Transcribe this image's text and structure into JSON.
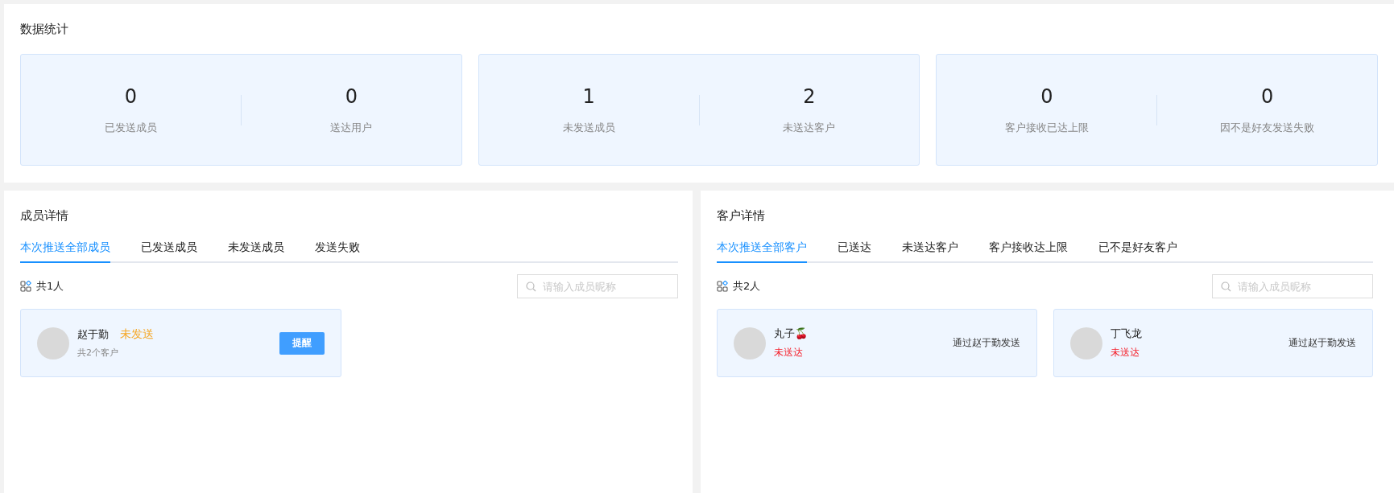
{
  "stats": {
    "title": "数据统计",
    "cards": [
      {
        "items": [
          {
            "value": "0",
            "label": "已发送成员"
          },
          {
            "value": "0",
            "label": "送达用户"
          }
        ]
      },
      {
        "items": [
          {
            "value": "1",
            "label": "未发送成员"
          },
          {
            "value": "2",
            "label": "未送达客户"
          }
        ]
      },
      {
        "items": [
          {
            "value": "0",
            "label": "客户接收已达上限"
          },
          {
            "value": "0",
            "label": "因不是好友发送失败"
          }
        ]
      }
    ]
  },
  "panels": [
    {
      "title": "成员详情",
      "tabs": [
        {
          "label": "本次推送全部成员",
          "selected": true
        },
        {
          "label": "已发送成员",
          "selected": false
        },
        {
          "label": "未发送成员",
          "selected": false
        },
        {
          "label": "发送失败",
          "selected": false
        }
      ],
      "count": "共1人",
      "search": {
        "placeholder": "请输入成员昵称"
      },
      "cards": [
        {
          "kind": "member",
          "name": "赵于勤",
          "status": {
            "text": "未发送",
            "kind": "pending"
          },
          "subtitle": "共2个客户",
          "button": "提醒"
        }
      ]
    },
    {
      "title": "客户详情",
      "tabs": [
        {
          "label": "本次推送全部客户",
          "selected": true
        },
        {
          "label": "已送达",
          "selected": false
        },
        {
          "label": "未送达客户",
          "selected": false
        },
        {
          "label": "客户接收达上限",
          "selected": false
        },
        {
          "label": "已不是好友客户",
          "selected": false
        }
      ],
      "count": "共2人",
      "search": {
        "placeholder": "请输入成员昵称"
      },
      "cards": [
        {
          "kind": "customer",
          "name": "丸子🍒",
          "status": {
            "text": "未送达",
            "kind": "failed"
          },
          "via": "通过赵于勤发送"
        },
        {
          "kind": "customer",
          "name": "丁飞龙",
          "status": {
            "text": "未送达",
            "kind": "failed"
          },
          "via": "通过赵于勤发送"
        }
      ]
    }
  ]
}
